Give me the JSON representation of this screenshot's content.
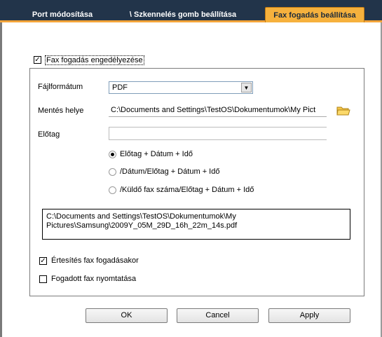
{
  "tabs": [
    {
      "label": "Port módosítása"
    },
    {
      "label": "\\ Szkennelés gomb beállítása"
    },
    {
      "label": "Fax fogadás beállítása"
    }
  ],
  "enable": {
    "label": "Fax fogadás engedélyezése",
    "checked": true
  },
  "file_format": {
    "label": "Fájlformátum",
    "value": "PDF"
  },
  "save_location": {
    "label": "Mentés helye",
    "value": "C:\\Documents and Settings\\TestOS\\Dokumentumok\\My Pict"
  },
  "prefix": {
    "label": "Előtag",
    "value": ""
  },
  "naming_options": [
    {
      "label": "Előtag + Dátum + Idő",
      "selected": true
    },
    {
      "label": "/Dátum/Előtag + Dátum + Idő",
      "selected": false
    },
    {
      "label": "/Küldő fax száma/Előtag + Dátum + Idő",
      "selected": false
    }
  ],
  "preview": {
    "line1": "C:\\Documents and Settings\\TestOS\\Dokumentumok\\My",
    "line2": "Pictures\\Samsung\\2009Y_05M_29D_16h_22m_14s.pdf"
  },
  "notify": {
    "label": "Értesítés fax fogadásakor",
    "checked": true
  },
  "print": {
    "label": "Fogadott fax nyomtatása",
    "checked": false
  },
  "buttons": {
    "ok": "OK",
    "cancel": "Cancel",
    "apply": "Apply"
  },
  "colors": {
    "tabbar": "#22344a",
    "active_tab": "#f6b13d",
    "accent_line": "#f3a43a"
  },
  "icons": {
    "folder": "folder-icon",
    "dropdown": "chevron-down-icon"
  }
}
